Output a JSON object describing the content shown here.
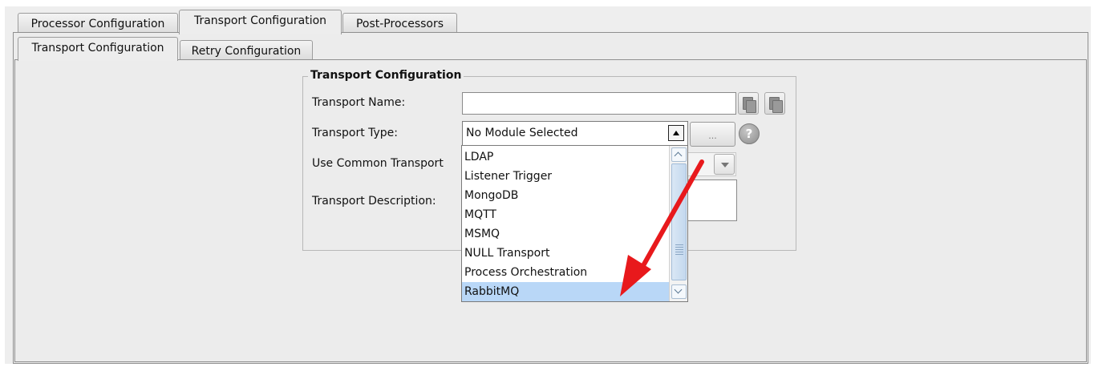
{
  "tabs": {
    "top": [
      {
        "label": "Processor Configuration"
      },
      {
        "label": "Transport Configuration"
      },
      {
        "label": "Post-Processors"
      }
    ],
    "sub": [
      {
        "label": "Transport Configuration"
      },
      {
        "label": "Retry Configuration"
      }
    ]
  },
  "group": {
    "title": "Transport Configuration",
    "name_label": "Transport Name:",
    "name_value": "",
    "type_label": "Transport Type:",
    "type_value": "No Module Selected",
    "ellipsis_label": "...",
    "help_label": "?",
    "common_label": "Use Common Transport",
    "description_label": "Transport Description:"
  },
  "dropdown": {
    "items": [
      {
        "label": "LDAP"
      },
      {
        "label": "Listener Trigger"
      },
      {
        "label": "MongoDB"
      },
      {
        "label": "MQTT"
      },
      {
        "label": "MSMQ"
      },
      {
        "label": "NULL Transport"
      },
      {
        "label": "Process Orchestration"
      },
      {
        "label": "RabbitMQ"
      }
    ],
    "selected": "RabbitMQ"
  },
  "colors": {
    "selection": "#b9d7f7",
    "annotation_arrow": "#e8191c",
    "panel": "#ececec"
  }
}
